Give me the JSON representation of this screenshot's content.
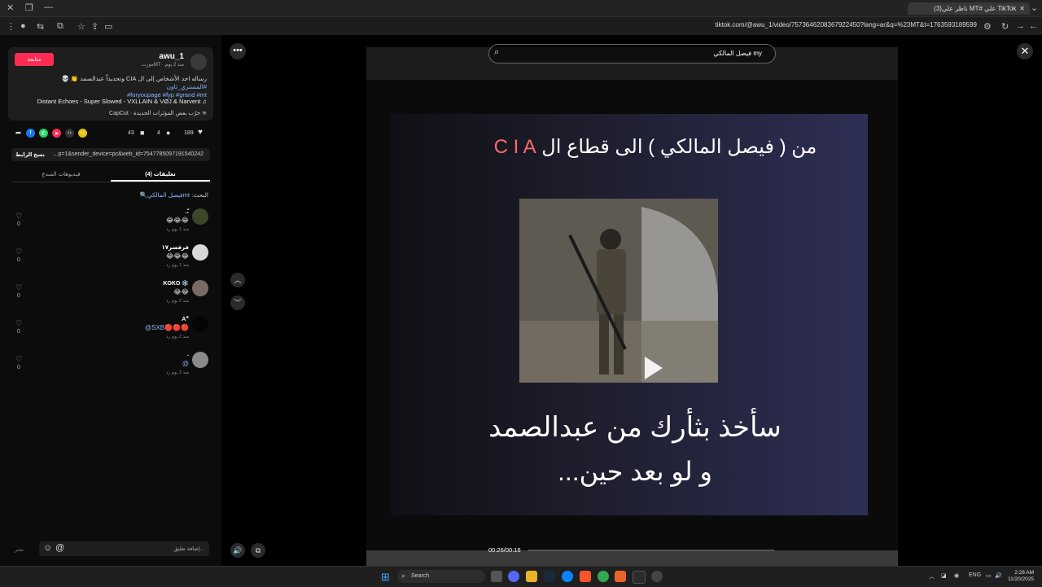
{
  "browser": {
    "tab_title": "(3)ناظر علي MT# علي TikTok",
    "url": "tiktok.com/@awu_1/video/7573646208367922450?lang=ar&q=%23MT&t=1763593189599"
  },
  "author": {
    "name": "awu_1",
    "meta": "موزتMT · منذ 2 يوم",
    "follow_label": "متابعة"
  },
  "post": {
    "description": "رساله احد الأشخاص إلى ال CIA وتحديداً عبدالصمد 👏 💀",
    "hashtags_line1": "#المستري_ثاون",
    "hashtags_line2": "#foryoupage #fyp #grand #mt",
    "music": "Distant Echoes - Super Slowed - VXLLAIN & VØJ & Narvent",
    "capcut": "CapCut · جرّب بعض المؤثرات الجديدة"
  },
  "actions": {
    "likes": "189",
    "comments": "4",
    "saves": "43"
  },
  "link": {
    "copy_label": "نسخ الرابط",
    "text": "...p=1&sender_device=pc&web_id=7547785097191540242"
  },
  "tabs": {
    "comments": "تعليقات (4)",
    "creator_videos": "فيديوهات المبدع"
  },
  "search_hint": {
    "prefix": "البحث:",
    "query": "mtفيصل المالكي"
  },
  "comments": [
    {
      "name": "..ّ",
      "text": "😂😂😂",
      "meta": "منذ 1 يوم   رد",
      "likes": "0"
    },
    {
      "name": "فرفسر١٧",
      "text": "😂😂😂",
      "meta": "منذ 1 يوم   رد",
      "likes": "0"
    },
    {
      "name": "KOKO ❄️",
      "text": "😂😂",
      "meta": "منذ 2 يوم   رد",
      "likes": "0"
    },
    {
      "name": "A\"ّ",
      "text": "@SXB🔴🔴🔴",
      "meta": "منذ 2 يوم   رد",
      "likes": "0"
    },
    {
      "name": ".",
      "text": "@",
      "meta": "منذ 2 يوم   رد",
      "likes": "0"
    }
  ],
  "comment_input": {
    "placeholder": "إضافة تعليق...",
    "post_label": "نشر"
  },
  "video": {
    "search_text": "فيصل المالكي my",
    "title_overlay": "من ( فيصل المالكي ) الى قطاع ال",
    "title_cia": "C I A",
    "subtitle_line1": "سأخذ بثأرك من عبدالصمد",
    "subtitle_line2": "و لو بعد حين...",
    "time": "00:26/00:16",
    "progress": 0
  },
  "taskbar": {
    "search_label": "Search",
    "lang": "ENG",
    "time": "2:28 AM",
    "date": "11/20/2025"
  }
}
